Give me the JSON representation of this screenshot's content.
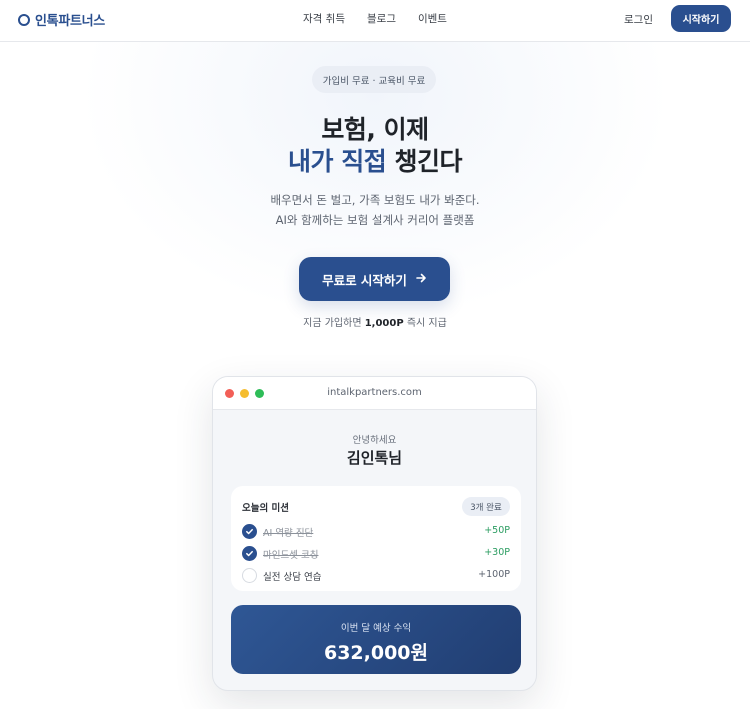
{
  "nav": {
    "logo_text": "인톡파트너스",
    "menu": [
      "자격 취득",
      "블로그",
      "이벤트"
    ],
    "login_label": "로그인",
    "start_label": "시작하기"
  },
  "hero": {
    "badge": "가입비 무료 · 교육비 무료",
    "title_line1": "보험, 이제",
    "title_accent": "내가 직접",
    "title_rest": " 챙긴다",
    "subtitle_line1": "배우면서 돈 벌고, 가족 보험도 내가 봐준다.",
    "subtitle_line2": "AI와 함께하는 보험 설계사 커리어 플랫폼",
    "cta_label": "무료로 시작하기",
    "cta_icon": "arrow-right-icon",
    "bonus_prefix": "지금 가입하면 ",
    "bonus_amount": "1,000P",
    "bonus_suffix": " 즉시 지급"
  },
  "mockup": {
    "url": "intalkpartners.com",
    "greeting": "안녕하세요",
    "user_name": "김인톡님",
    "mission_title": "오늘의 미션",
    "completed_badge": "3개 완료",
    "tasks": [
      {
        "label": "AI 역량 진단",
        "points": "+50P",
        "done": true
      },
      {
        "label": "마인드셋 코칭",
        "points": "+30P",
        "done": true
      },
      {
        "label": "실전 상담 연습",
        "points": "+100P",
        "done": false
      }
    ],
    "earnings_label": "이번 달 예상 수익",
    "earnings_value": "632,000원"
  },
  "colors": {
    "brand": "#2a4f8f",
    "points_green": "#2c9d62",
    "dot_red": "#f25f57",
    "dot_yellow": "#f5bd2f",
    "dot_green": "#2ebd58"
  }
}
